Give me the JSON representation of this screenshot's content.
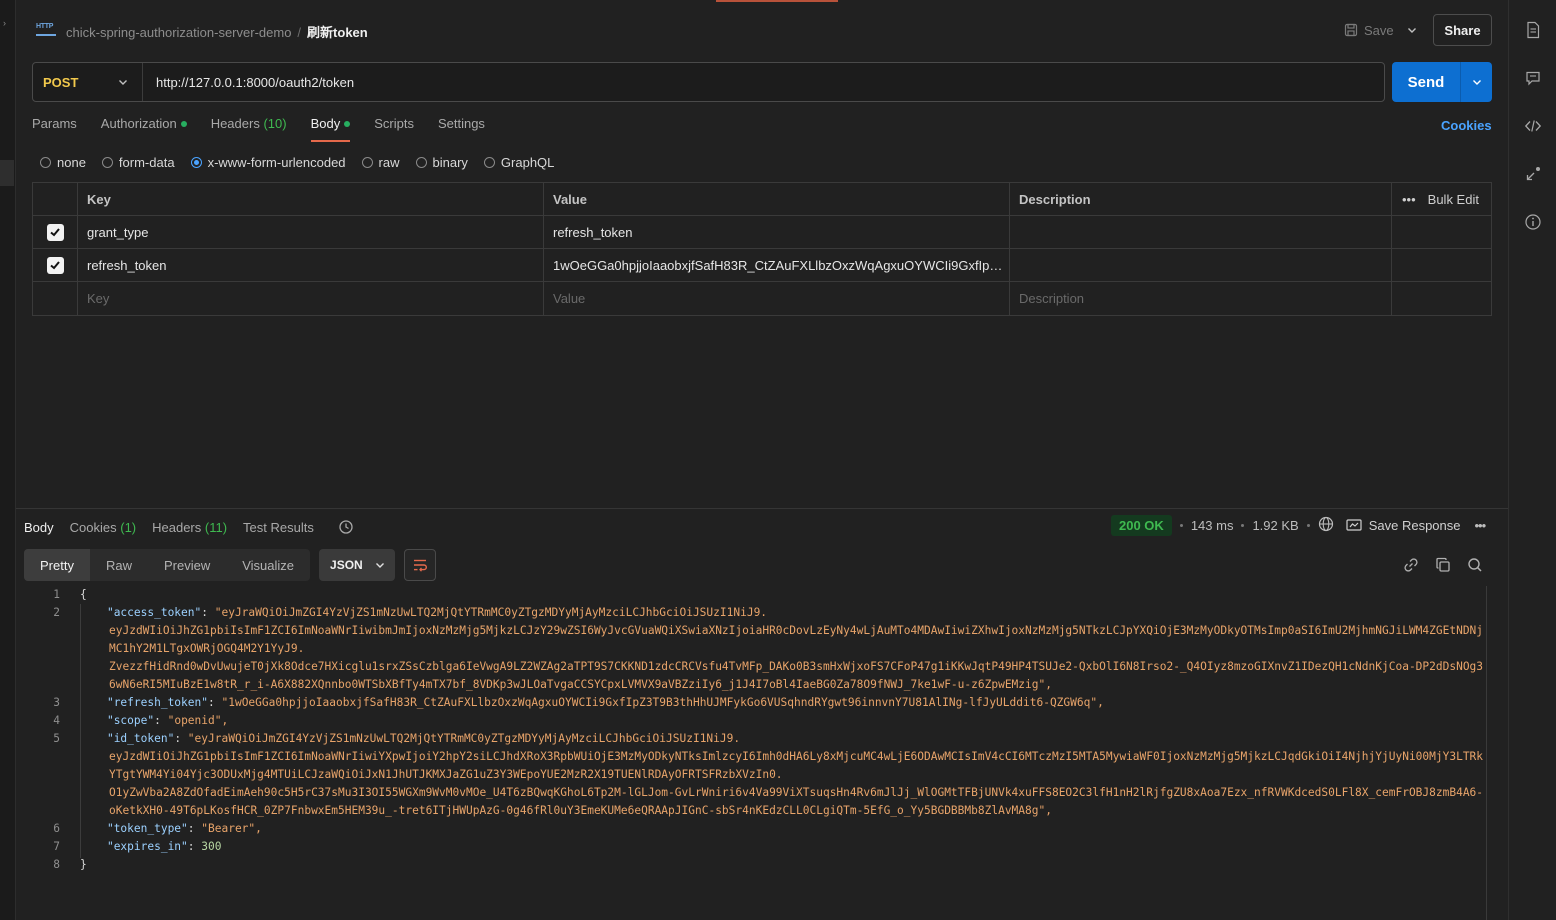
{
  "header": {
    "badge": "HTTP",
    "collection": "chick-spring-authorization-server-demo",
    "separator": "/",
    "request_name": "刷新token",
    "save_label": "Save",
    "share_label": "Share"
  },
  "url_bar": {
    "method": "POST",
    "url": "http://127.0.0.1:8000/oauth2/token",
    "send_label": "Send"
  },
  "request_tabs": [
    {
      "label": "Params"
    },
    {
      "label": "Authorization"
    },
    {
      "label": "Headers",
      "count": "(10)"
    },
    {
      "label": "Body"
    },
    {
      "label": "Scripts"
    },
    {
      "label": "Settings"
    }
  ],
  "cookies_label": "Cookies",
  "body_types": [
    "none",
    "form-data",
    "x-www-form-urlencoded",
    "raw",
    "binary",
    "GraphQL"
  ],
  "body_type_selected": "x-www-form-urlencoded",
  "params_table": {
    "headers": {
      "key": "Key",
      "value": "Value",
      "description": "Description",
      "bulk_edit": "Bulk Edit"
    },
    "rows": [
      {
        "key": "grant_type",
        "value": "refresh_token",
        "checked": true
      },
      {
        "key": "refresh_token",
        "value": "1wOeGGa0hpjjoIaaobxjfSafH83R_CtZAuFXLlbzOxzWqAgxuOYWCIi9GxfIpZ3T…",
        "checked": true
      }
    ],
    "placeholders": {
      "key": "Key",
      "value": "Value",
      "description": "Description"
    }
  },
  "response_tabs": [
    {
      "label": "Body"
    },
    {
      "label": "Cookies",
      "count": "(1)"
    },
    {
      "label": "Headers",
      "count": "(11)"
    },
    {
      "label": "Test Results"
    }
  ],
  "response_meta": {
    "status": "200 OK",
    "time": "143 ms",
    "size": "1.92 KB",
    "save_response": "Save Response"
  },
  "view_options": [
    "Pretty",
    "Raw",
    "Preview",
    "Visualize"
  ],
  "view_selected": "Pretty",
  "format": "JSON",
  "code_lines": [
    {
      "n": "1",
      "text": "{"
    },
    {
      "n": "2",
      "key": "\"access_token\"",
      "value": "\"eyJraWQiOiJmZGI4YzVjZS1mNzUwLTQ2MjQtYTRmMC0yZTgzMDYyMjAyMzciLCJhbGciOiJSUzI1NiJ9.",
      "cont": [
        "eyJzdWIiOiJhZG1pbiIsImF1ZCI6ImNoaWNrIiwibmJmIjoxNzMzMjg5MjkzLCJzY29wZSI6WyJvcGVuaWQiXSwiaXNzIjoiaHR0cDovLzEyNy4wLjAuMTo4MDAwIiwiZXhwIjoxNzMzMjg5NTkzLCJpYXQiOjE3MzMyODkyOTMsImp0aSI6ImU2MjhmNGJiLWM4ZGEtNDNjMC1hY2M1LTgxOWRjOGQ4M2Y1YyJ9.",
        "ZvezzfHidRnd0wDvUwujeT0jXk8Odce7HXicglu1srxZSsCzblga6IeVwgA9LZ2WZAg2aTPT9S7CKKND1zdcCRCVsfu4TvMFp_DAKo0B3smHxWjxoFS7CFoP47g1iKKwJqtP49HP4TSUJe2-QxbOlI6N8Irso2-_Q4OIyz8mzoGIXnvZ1IDezQH1cNdnKjCoa-DP2dDsNOg36wN6eRI5MIuBzE1w8tR_r_i-A6X882XQnnbo0WTSbXBfTy4mTX7bf_8VDKp3wJLOaTvgaCCSYCpxLVMVX9aVBZziIy6_j1J4I7oBl4IaeBG0Za78O9fNWJ_7ke1wF-u-z6ZpwEMzig\","
      ]
    },
    {
      "n": "3",
      "key": "\"refresh_token\"",
      "value": "\"1wOeGGa0hpjjoIaaobxjfSafH83R_CtZAuFXLlbzOxzWqAgxuOYWCIi9GxfIpZ3T9B3thHhUJMFykGo6VUSqhndRYgwt96innvnY7U81AlINg-lfJyULddit6-QZGW6q\","
    },
    {
      "n": "4",
      "key": "\"scope\"",
      "value": "\"openid\","
    },
    {
      "n": "5",
      "key": "\"id_token\"",
      "value": "\"eyJraWQiOiJmZGI4YzVjZS1mNzUwLTQ2MjQtYTRmMC0yZTgzMDYyMjAyMzciLCJhbGciOiJSUzI1NiJ9.",
      "cont": [
        "eyJzdWIiOiJhZG1pbiIsImF1ZCI6ImNoaWNrIiwiYXpwIjoiY2hpY2siLCJhdXRoX3RpbWUiOjE3MzMyODkyNTksImlzcyI6Imh0dHA6Ly8xMjcuMC4wLjE6ODAwMCIsImV4cCI6MTczMzI5MTA5MywiaWF0IjoxNzMzMjg5MjkzLCJqdGkiOiI4NjhjYjUyNi00MjY3LTRkYTgtYWM4Yi04Yjc3ODUxMjg4MTUiLCJzaWQiOiJxN1JhUTJKMXJaZG1uZ3Y3WEpoYUE2MzR2X19TUENlRDAyOFRTSFRzbXVzIn0.",
        "O1yZwVba2A8ZdOfadEimAeh90c5H5rC37sMu3I3OI55WGXm9WvM0vMOe_U4T6zBQwqKGhoL6Tp2M-lGLJom-GvLrWniri6v4Va99ViXTsuqsHn4Rv6mJlJj_WlOGMtTFBjUNVk4xuFFS8EO2C3lfH1nH2lRjfgZU8xAoa7Ezx_nfRVWKdcedS0LFl8X_cemFrOBJ8zmB4A6-oKetkXH0-49T6pLKosfHCR_0ZP7FnbwxEm5HEM39u_-tret6ITjHWUpAzG-0g46fRl0uY3EmeKUMe6eQRAApJIGnC-sbSr4nKEdzCLL0CLgiQTm-5EfG_o_Yy5BGDBBMb8ZlAvMA8g\","
      ]
    },
    {
      "n": "6",
      "key": "\"token_type\"",
      "value": "\"Bearer\","
    },
    {
      "n": "7",
      "key": "\"expires_in\"",
      "number": "300"
    },
    {
      "n": "8",
      "text": "}"
    }
  ],
  "colors": {
    "accent": "#e5694b",
    "send": "#0d6fd1",
    "method": "#f2c94c",
    "status": "#3fb950",
    "link": "#4aa3ff"
  }
}
